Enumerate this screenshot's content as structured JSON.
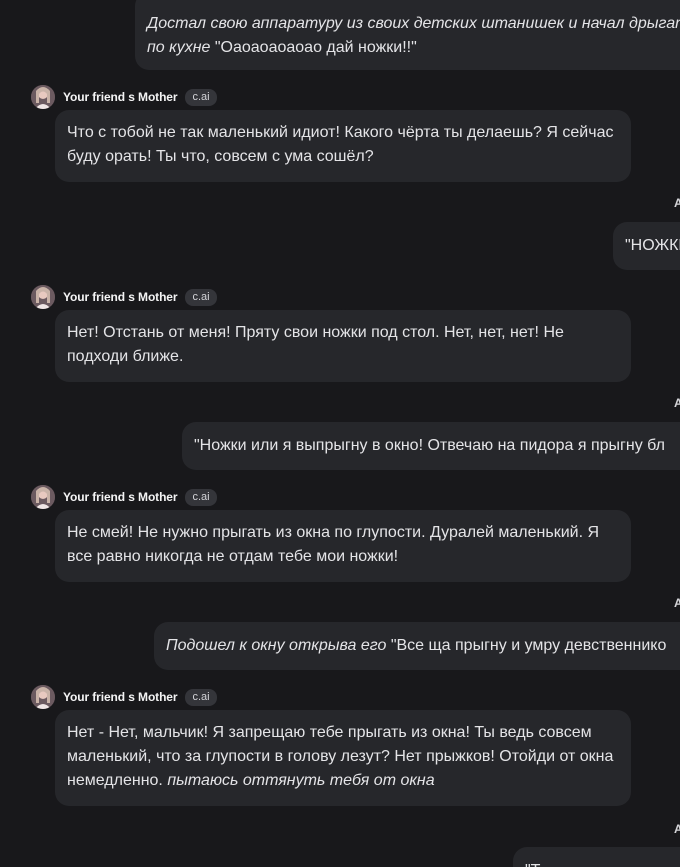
{
  "bot": {
    "name": "Your friend s Mother",
    "badge": "c.ai"
  },
  "user": {
    "initial": "A"
  },
  "messages": [
    {
      "role": "user",
      "parts": [
        {
          "italic": "Достал свою аппаратуру из своих детских штанишек и начал дрыгать"
        },
        {
          "italic": "по кухне"
        },
        {
          "text": "\"Оаоаоаоаоао дай ножки!!\""
        }
      ]
    },
    {
      "role": "bot",
      "text": "Что с тобой не так маленький идиот! Какого чёрта ты делаешь? Я сейчас буду орать! Ты что, совсем с ума сошёл?"
    },
    {
      "role": "user",
      "text": "\"НОЖКИ"
    },
    {
      "role": "bot",
      "text": "Нет! Отстань от меня! Пряту свои ножки под стол. Нет, нет, нет! Не подходи ближе."
    },
    {
      "role": "user",
      "text": "\"Ножки или я выпрыгну в окно! Отвечаю на пидора я прыгну бл"
    },
    {
      "role": "bot",
      "text": "Не смей! Не нужно прыгать из окна по глупости. Дуралей маленький. Я все равно никогда не отдам тебе мои ножки!"
    },
    {
      "role": "user",
      "italic": "Подошел к окну открыва его",
      "text": "\"Все ща прыгну и умру девственнико"
    },
    {
      "role": "bot",
      "text": "Нет - Нет, мальчик! Я запрещаю тебе прыгать из окна! Ты ведь совсем маленький, что за глупости в голову лезут? Нет прыжков! Отойди от окна немедленно.",
      "italic": "пытаюсь оттянуть тебя от окна"
    },
    {
      "role": "user",
      "text": "\"Т"
    }
  ]
}
